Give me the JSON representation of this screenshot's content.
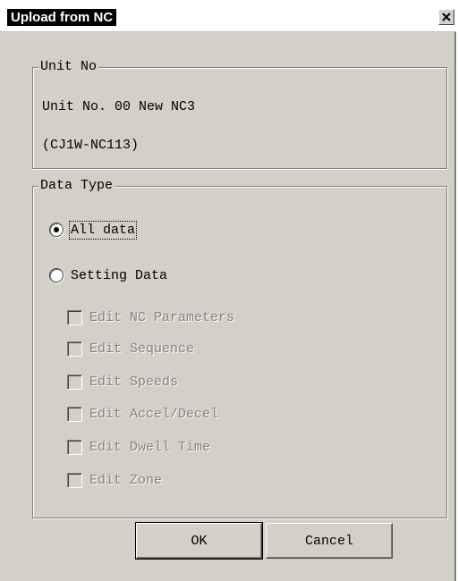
{
  "window": {
    "title": "Upload from NC",
    "close_icon": "close-x-icon"
  },
  "unit_group": {
    "legend": "Unit No",
    "unit_name": "Unit No. 00 New NC3",
    "model": "(CJ1W-NC113)"
  },
  "data_type_group": {
    "legend": "Data Type",
    "radio_all": {
      "label": "All data",
      "checked": true
    },
    "radio_setting": {
      "label": "Setting Data",
      "checked": false
    },
    "checkboxes": [
      {
        "label": "Edit NC Parameters",
        "checked": false,
        "enabled": false
      },
      {
        "label": "Edit Sequence",
        "checked": false,
        "enabled": false
      },
      {
        "label": "Edit Speeds",
        "checked": false,
        "enabled": false
      },
      {
        "label": "Edit Accel/Decel",
        "checked": false,
        "enabled": false
      },
      {
        "label": "Edit Dwell Time",
        "checked": false,
        "enabled": false
      },
      {
        "label": "Edit Zone",
        "checked": false,
        "enabled": false
      }
    ]
  },
  "buttons": {
    "ok": "OK",
    "cancel": "Cancel"
  },
  "colors": {
    "dialog_face": "#d4d0c8",
    "title_highlight": "#000000",
    "disabled_text": "#808080"
  }
}
